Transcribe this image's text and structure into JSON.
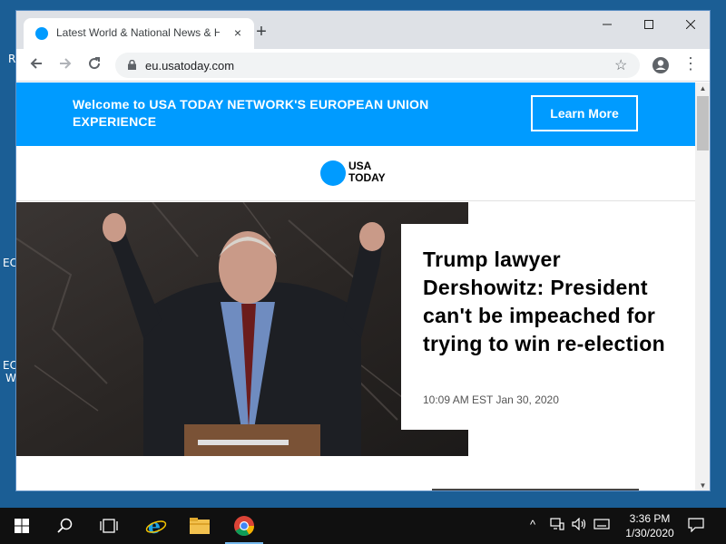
{
  "desktop": {
    "fragments": [
      "R",
      "EC",
      "EC",
      "W"
    ]
  },
  "browser": {
    "tab_title": "Latest World & National News & Headlines",
    "tab_close": "×",
    "new_tab": "+",
    "url": "eu.usatoday.com"
  },
  "banner": {
    "text": "Welcome to USA TODAY NETWORK'S EUROPEAN UNION EXPERIENCE",
    "button": "Learn More"
  },
  "site": {
    "logo_line1": "USA",
    "logo_line2": "TODAY"
  },
  "article": {
    "headline": "Trump lawyer Dershowitz: President can't be impeached for trying to win re-election",
    "timestamp": "10:09 AM EST Jan 30, 2020"
  },
  "taskbar": {
    "time": "3:36 PM",
    "date": "1/30/2020"
  },
  "colors": {
    "accent": "#009bff",
    "taskbar": "#101010",
    "desktop": "#1b5e95"
  }
}
